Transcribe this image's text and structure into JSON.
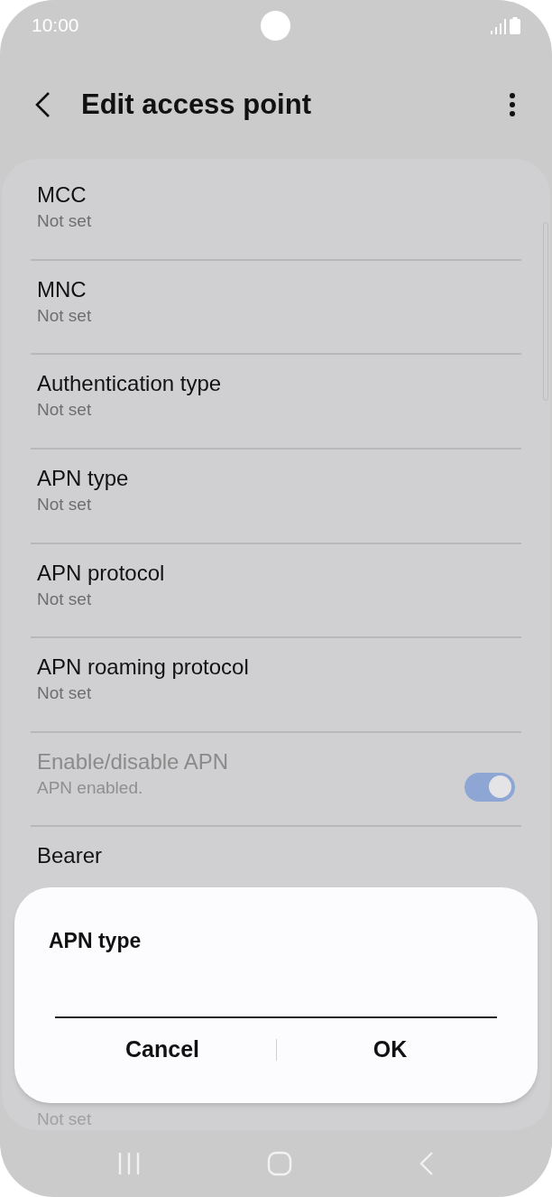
{
  "status_bar": {
    "time": "10:00"
  },
  "header": {
    "title": "Edit access point"
  },
  "items": [
    {
      "kind": "text",
      "title": "MCC",
      "subtitle": "Not set"
    },
    {
      "kind": "text",
      "title": "MNC",
      "subtitle": "Not set"
    },
    {
      "kind": "text",
      "title": "Authentication type",
      "subtitle": "Not set"
    },
    {
      "kind": "text",
      "title": "APN type",
      "subtitle": "Not set"
    },
    {
      "kind": "text",
      "title": "APN protocol",
      "subtitle": "Not set"
    },
    {
      "kind": "text",
      "title": "APN roaming protocol",
      "subtitle": "Not set"
    },
    {
      "kind": "switch",
      "title": "Enable/disable APN",
      "subtitle": "APN enabled.",
      "on": true,
      "disabled": true
    },
    {
      "kind": "text",
      "title": "Bearer"
    },
    {
      "kind": "tail",
      "subtitle": "Not set"
    }
  ],
  "dialog": {
    "title": "APN type",
    "buttons": [
      "Cancel",
      "OK"
    ]
  }
}
